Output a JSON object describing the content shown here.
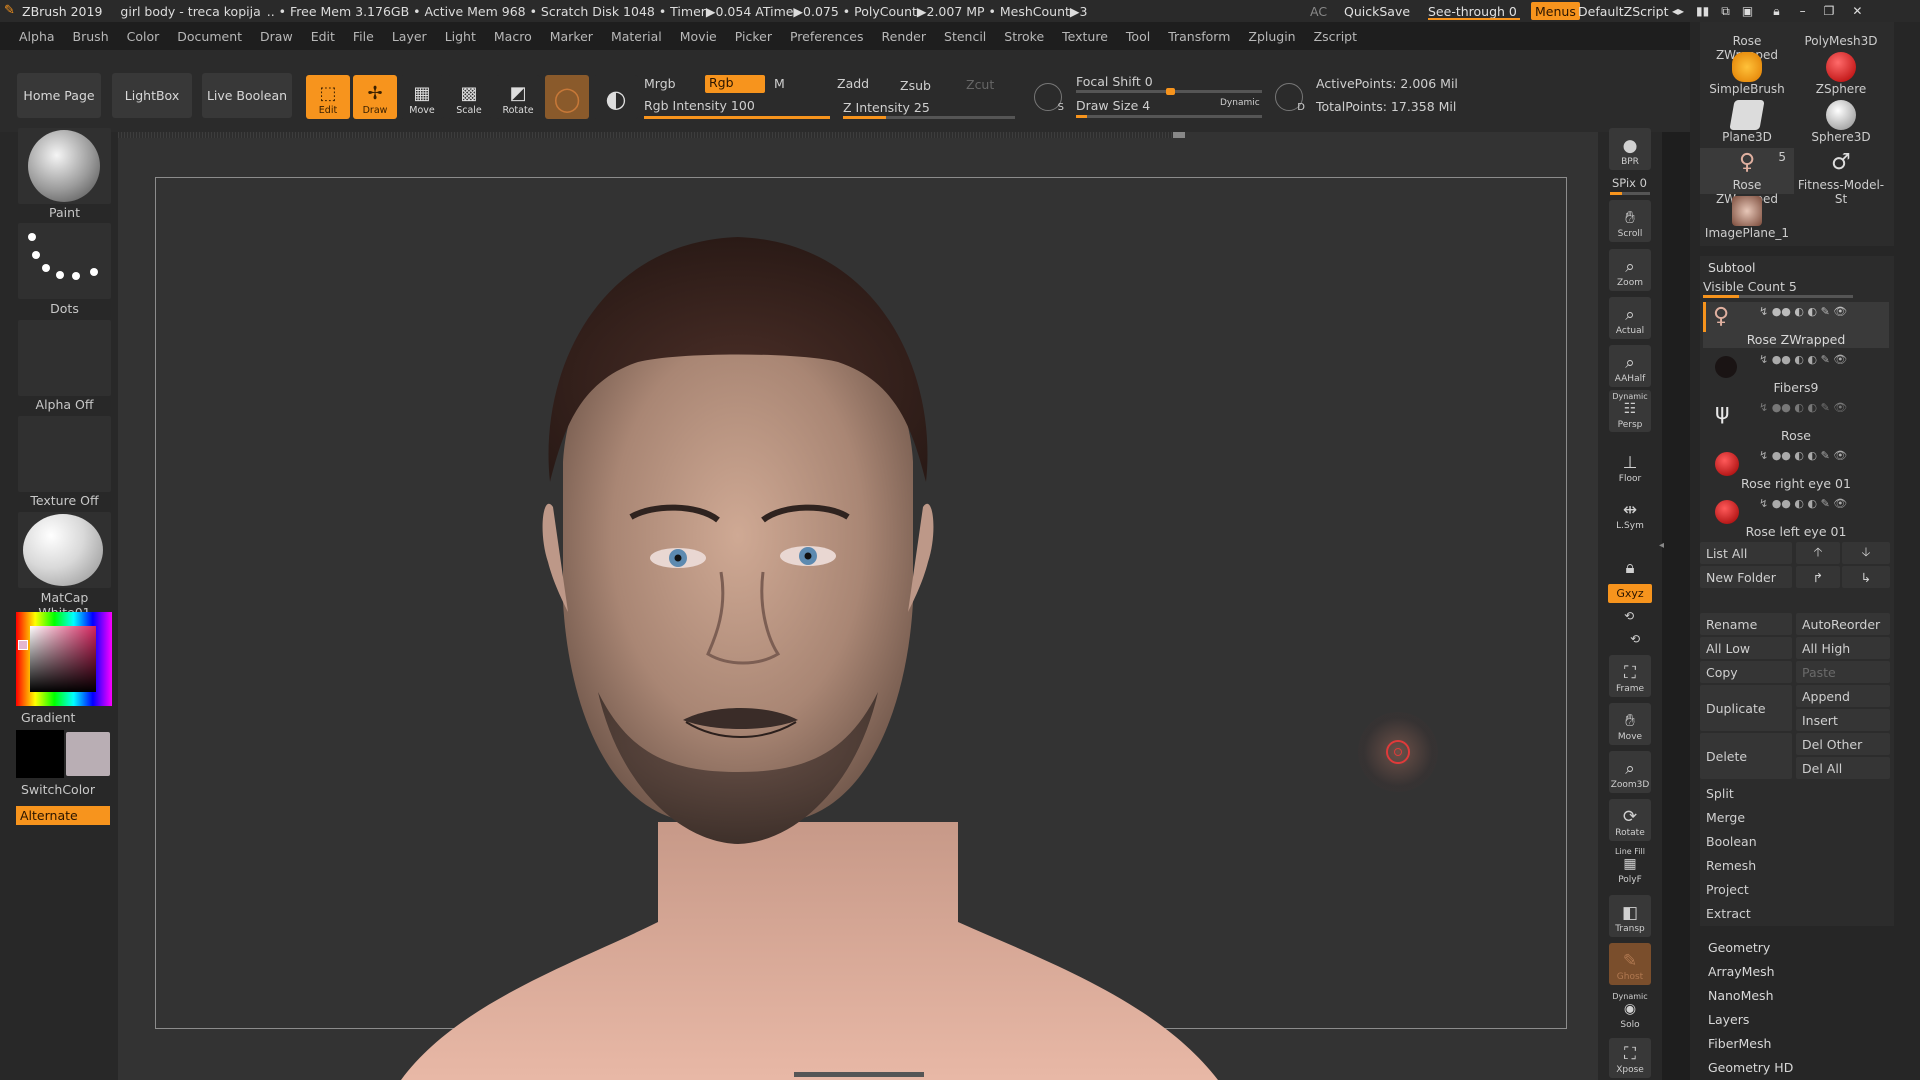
{
  "titlebar": {
    "app": "ZBrush 2019",
    "document": "girl body - treca kopija",
    "stats": ".. • Free Mem 3.176GB • Active Mem 968 • Scratch Disk 1048 • Timer▶0.054 ATime▶0.075 • PolyCount▶2.007 MP • MeshCount▶3",
    "ac": "AC",
    "quicksave": "QuickSave",
    "see_through": "See-through  0",
    "menus": "Menus",
    "script": "DefaultZScript"
  },
  "menubar": [
    "Alpha",
    "Brush",
    "Color",
    "Document",
    "Draw",
    "Edit",
    "File",
    "Layer",
    "Light",
    "Macro",
    "Marker",
    "Material",
    "Movie",
    "Picker",
    "Preferences",
    "Render",
    "Stencil",
    "Stroke",
    "Texture",
    "Tool",
    "Transform",
    "Zplugin",
    "Zscript"
  ],
  "toolbar": {
    "home_page": "Home Page",
    "lightbox": "LightBox",
    "live_boolean": "Live Boolean",
    "edit": "Edit",
    "draw": "Draw",
    "move": "Move",
    "scale": "Scale",
    "rotate": "Rotate",
    "mrgb": "Mrgb",
    "rgb": "Rgb",
    "m": "M",
    "zadd": "Zadd",
    "zsub": "Zsub",
    "zcut": "Zcut",
    "rgb_intensity": "Rgb Intensity 100",
    "z_intensity": "Z Intensity 25",
    "focal_shift": "Focal Shift 0",
    "draw_size": "Draw Size 4",
    "dynamic": "Dynamic",
    "active_points": "ActivePoints: 2.006 Mil",
    "total_points": "TotalPoints: 17.358 Mil",
    "rgb_intensity_value": 100,
    "z_intensity_value": 25,
    "draw_size_value": 4
  },
  "leftpanel": {
    "paint": "Paint",
    "dots": "Dots",
    "alpha": "Alpha Off",
    "texture": "Texture Off",
    "matcap": "MatCap White01",
    "gradient": "Gradient",
    "switchcolor": "SwitchColor",
    "alternate": "Alternate"
  },
  "righttools": {
    "bpr": "BPR",
    "spix": "SPix 0",
    "scroll": "Scroll",
    "zoom": "Zoom",
    "actual": "Actual",
    "aahalf": "AAHalf",
    "dynamic": "Dynamic",
    "persp": "Persp",
    "floor": "Floor",
    "lsym": "L.Sym",
    "xyz": "Gxyz",
    "frame": "Frame",
    "move": "Move",
    "zoom3d": "Zoom3D",
    "rotate": "Rotate",
    "linefill": "Line Fill",
    "polyf": "PolyF",
    "transp": "Transp",
    "ghost": "Ghost",
    "dynamic2": "Dynamic",
    "solo": "Solo",
    "xpose": "Xpose"
  },
  "tools": {
    "items": [
      {
        "label": "Rose ZWrapped"
      },
      {
        "label": "PolyMesh3D"
      },
      {
        "label": "SimpleBrush"
      },
      {
        "label": "ZSphere"
      },
      {
        "label": "Plane3D"
      },
      {
        "label": "Sphere3D"
      },
      {
        "label": "Rose ZWrapped",
        "badge": "5"
      },
      {
        "label": "Fitness-Model-St"
      },
      {
        "label": "ImagePlane_1"
      }
    ]
  },
  "subtool": {
    "title": "Subtool",
    "visible_count": "Visible Count 5",
    "items": [
      {
        "name": "Rose ZWrapped"
      },
      {
        "name": "Fibers9"
      },
      {
        "name": "Rose"
      },
      {
        "name": "Rose right eye 01"
      },
      {
        "name": "Rose left eye 01"
      }
    ],
    "list_all": "List All",
    "new_folder": "New Folder",
    "rename": "Rename",
    "autoreorder": "AutoReorder",
    "all_low": "All Low",
    "all_high": "All High",
    "copy": "Copy",
    "paste": "Paste",
    "duplicate": "Duplicate",
    "append": "Append",
    "insert": "Insert",
    "delete": "Delete",
    "del_other": "Del Other",
    "del_all": "Del All",
    "split": "Split",
    "merge": "Merge",
    "boolean": "Boolean",
    "remesh": "Remesh",
    "project": "Project",
    "extract": "Extract"
  },
  "palettes": [
    "Geometry",
    "ArrayMesh",
    "NanoMesh",
    "Layers",
    "FiberMesh",
    "Geometry HD"
  ],
  "colors": {
    "accent": "#f7941d",
    "bg": "#333333",
    "panel": "#282828"
  }
}
